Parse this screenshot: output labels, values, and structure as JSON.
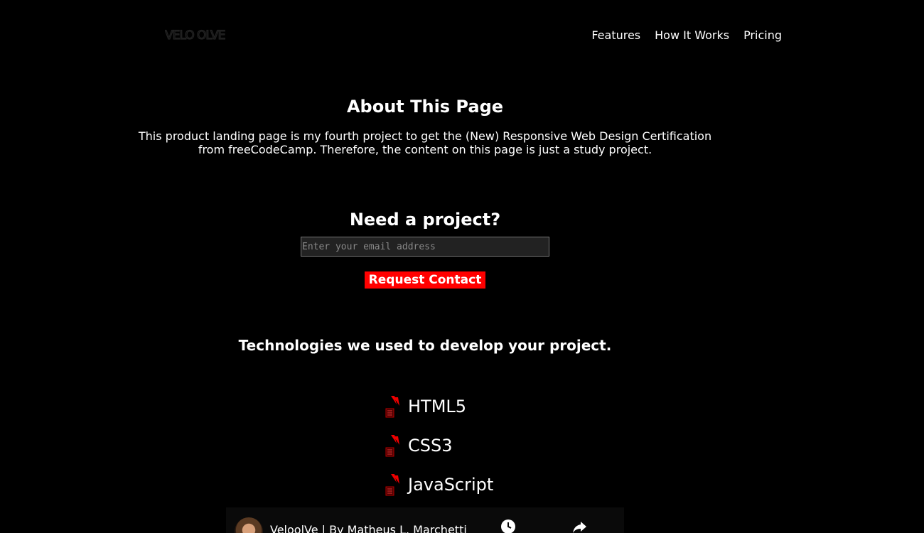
{
  "header": {
    "logo_text": "VELO OLVE",
    "nav": [
      "Features",
      "How It Works",
      "Pricing"
    ]
  },
  "about": {
    "title": "About This Page",
    "text": "This product landing page is my fourth project to get the (New) Responsive Web Design Certification from freeCodeCamp. Therefore, the content on this page is just a study project."
  },
  "contact": {
    "title": "Need a project?",
    "email_placeholder": "Enter your email address",
    "button_label": "Request Contact"
  },
  "tech": {
    "title": "Technologies we used to develop your project.",
    "items": [
      "HTML5",
      "CSS3",
      "JavaScript"
    ]
  },
  "video": {
    "title": "VeloolVe | By Matheus L. Marchetti",
    "icons": [
      "clock-icon",
      "share-icon"
    ]
  },
  "colors": {
    "background": "#000000",
    "accent": "#ff0000"
  }
}
